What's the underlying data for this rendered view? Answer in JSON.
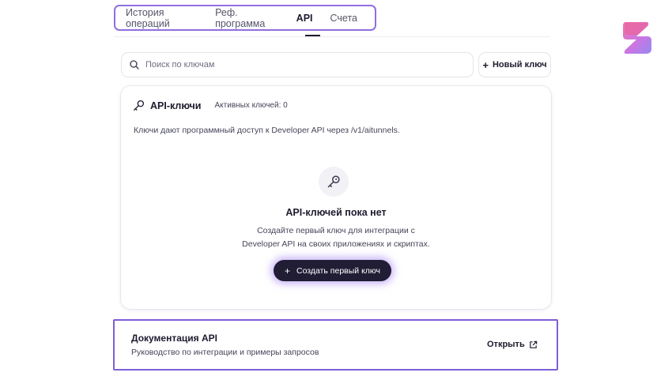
{
  "tabs": [
    {
      "label": "История операций",
      "active": false
    },
    {
      "label": "Реф. программа",
      "active": false
    },
    {
      "label": "API",
      "active": true
    },
    {
      "label": "Счета",
      "active": false
    }
  ],
  "search": {
    "placeholder": "Поиск по ключам",
    "value": ""
  },
  "new_key_button": {
    "label": "Новый ключ",
    "icon": "plus-icon"
  },
  "api_keys_card": {
    "title": "API-ключи",
    "title_icon": "key-icon",
    "active_count_label": "Активных ключей: 0",
    "description": "Ключи дают программный доступ к Developer API через /v1/aitunnels.",
    "empty_state": {
      "icon": "key-icon",
      "title": "API-ключей пока нет",
      "text_line1": "Создайте первый ключ для интеграции с",
      "text_line2": "Developer API на своих приложениях и скриптах.",
      "button_label": "Создать первый ключ"
    }
  },
  "docs_card": {
    "title": "Документация API",
    "subtitle": "Руководство по интеграции и примеры запросов",
    "open_label": "Открыть",
    "open_icon": "external-link-icon"
  },
  "colors": {
    "accent_border": "#8f6fe0",
    "dark_button": "#201d35",
    "glow": "#966ef0"
  }
}
